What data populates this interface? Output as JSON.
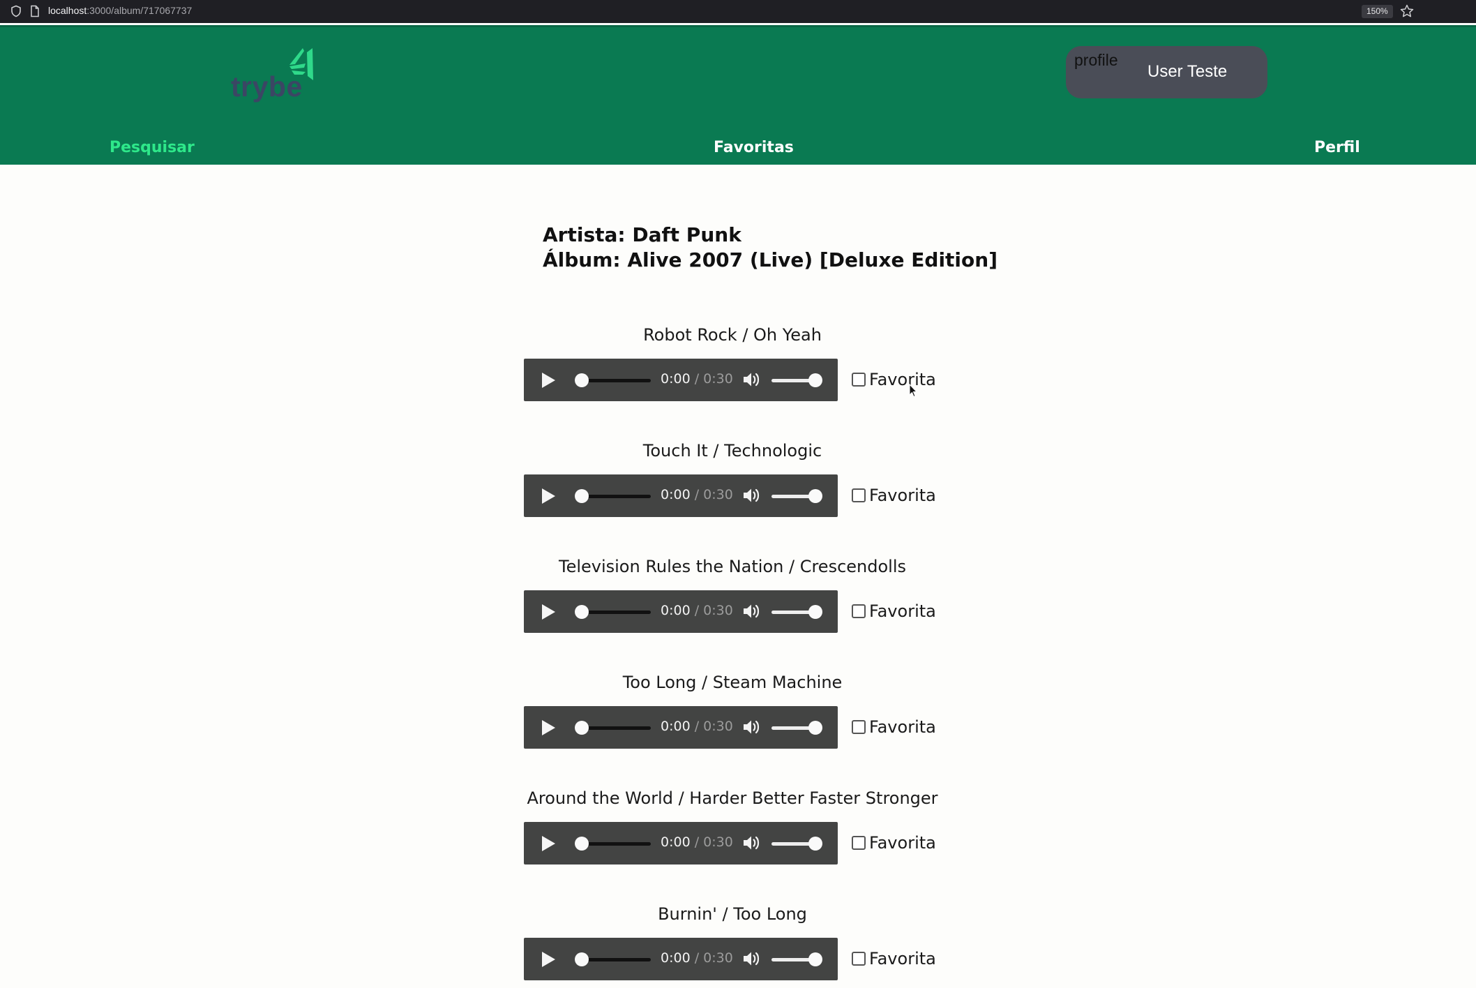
{
  "browser": {
    "url_host": "localhost",
    "url_path": ":3000/album/717067737",
    "zoom": "150%"
  },
  "header": {
    "logo_text": "trybe",
    "profile_alt": "profile",
    "user_name": "User Teste",
    "nav": {
      "search": "Pesquisar",
      "favorites": "Favoritas",
      "profile": "Perfil"
    }
  },
  "album": {
    "artist_line": "Artista: Daft Punk",
    "album_line": "Álbum: Alive 2007 (Live) [Deluxe Edition]"
  },
  "player": {
    "current_time": "0:00",
    "separator": " / ",
    "duration": "0:30",
    "favorite_label": "Favorita"
  },
  "tracks": [
    {
      "name": "Robot Rock / Oh Yeah",
      "favorite": false
    },
    {
      "name": "Touch It / Technologic",
      "favorite": false
    },
    {
      "name": "Television Rules the Nation / Crescendolls",
      "favorite": false
    },
    {
      "name": "Too Long / Steam Machine",
      "favorite": false
    },
    {
      "name": "Around the World / Harder Better Faster Stronger",
      "favorite": false
    },
    {
      "name": "Burnin' / Too Long",
      "favorite": false
    }
  ],
  "colors": {
    "header_bg": "#0a7a52",
    "nav_active": "#2ee88a",
    "logo_green": "#2fd98a",
    "player_bg": "#434443"
  }
}
